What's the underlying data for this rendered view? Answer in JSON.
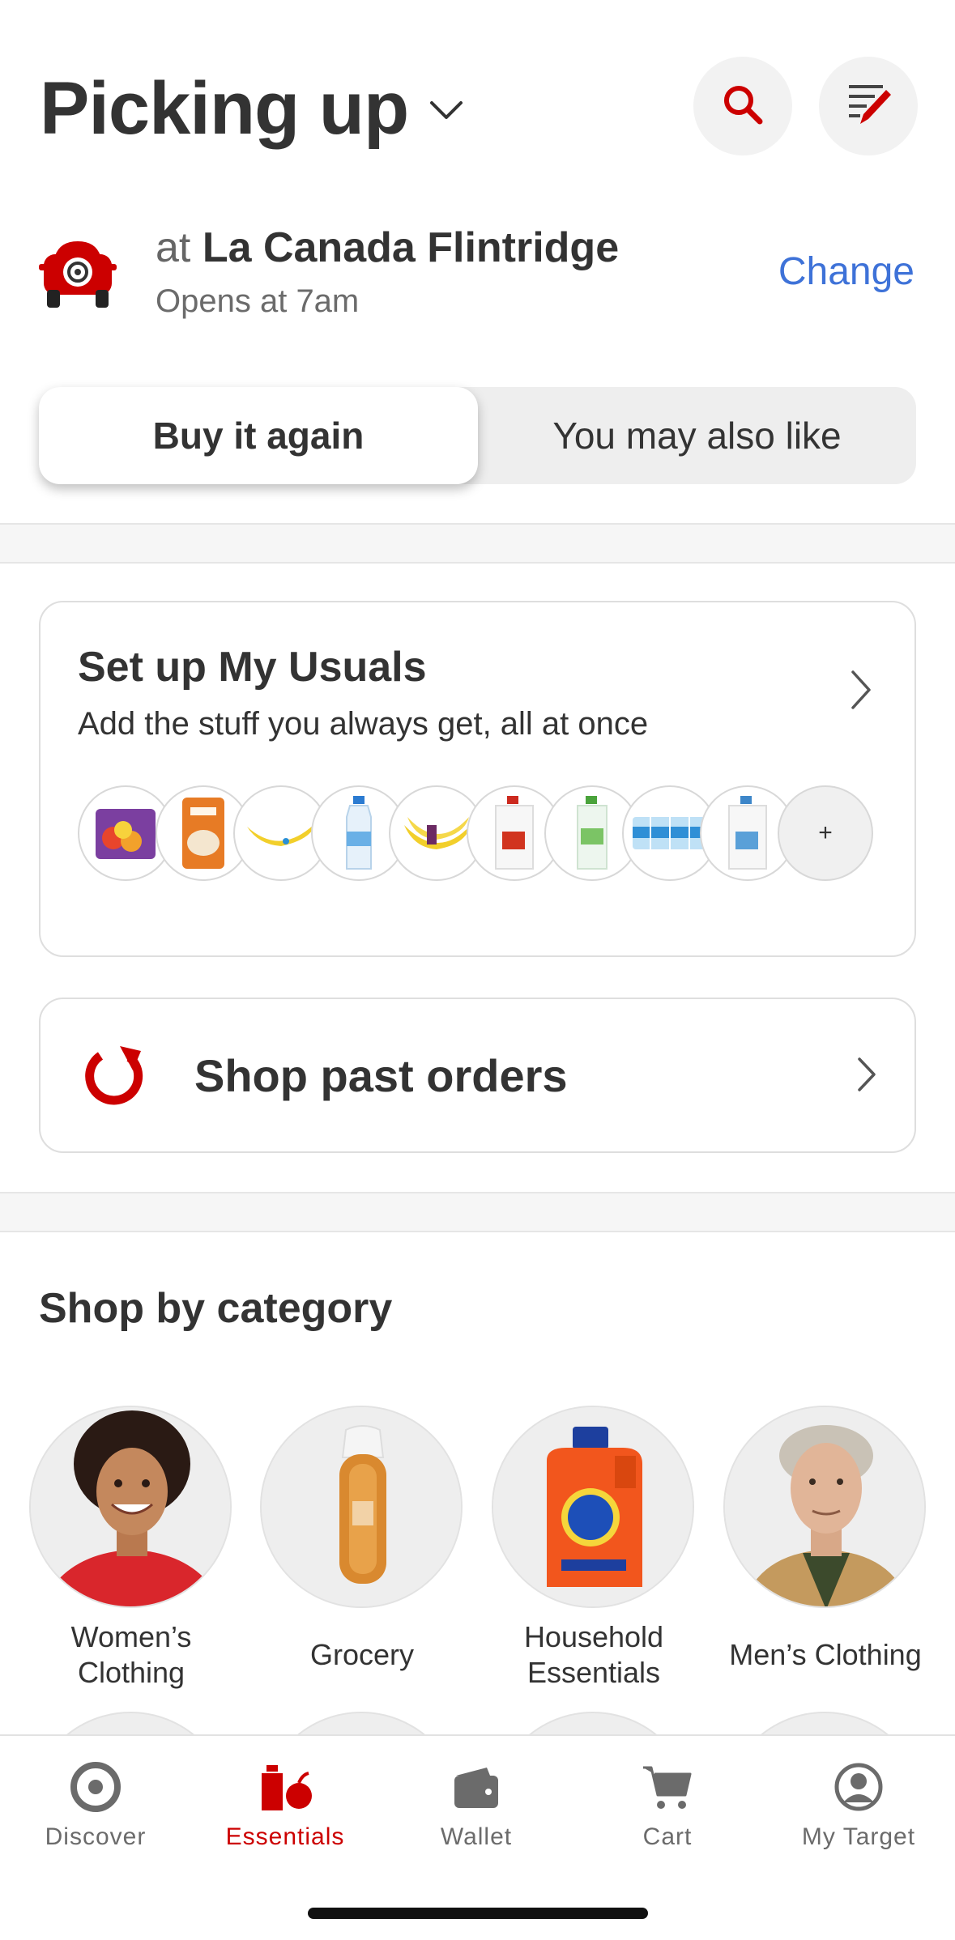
{
  "header": {
    "title": "Picking up",
    "chevron_icon": "chevron-down-icon",
    "search_icon": "search-icon",
    "list_icon": "shopping-list-icon"
  },
  "store": {
    "prefix": "at",
    "name": "La Canada Flintridge",
    "hours": "Opens at 7am",
    "change_label": "Change",
    "icon": "drive-up-car-icon"
  },
  "segmented": {
    "active": "Buy it again",
    "inactive": "You may also like"
  },
  "usuals": {
    "title": "Set up My Usuals",
    "subtitle": "Add the stuff you always get, all at once",
    "more_label": "+",
    "items": [
      "peppers-bag-icon",
      "rice-bag-icon",
      "banana-icon",
      "water-bottle-icon",
      "banana-bunch-icon",
      "milk-gallon-icon",
      "water-jug-icon",
      "water-case-icon",
      "milk-jug-icon"
    ]
  },
  "past_orders": {
    "label": "Shop past orders",
    "icon": "reorder-icon"
  },
  "categories": {
    "title": "Shop by category",
    "items": [
      {
        "label_line1": "Women’s",
        "label_line2": "Clothing"
      },
      {
        "label_line1": "Grocery",
        "label_line2": ""
      },
      {
        "label_line1": "Household",
        "label_line2": "Essentials"
      },
      {
        "label_line1": "Men’s Clothing",
        "label_line2": ""
      }
    ]
  },
  "tabbar": {
    "items": [
      {
        "label": "Discover",
        "icon": "target-logo-icon"
      },
      {
        "label": "Essentials",
        "icon": "essentials-icon"
      },
      {
        "label": "Wallet",
        "icon": "wallet-icon"
      },
      {
        "label": "Cart",
        "icon": "cart-icon"
      },
      {
        "label": "My Target",
        "icon": "account-icon"
      }
    ],
    "active_color": "#cc0000"
  },
  "colors": {
    "brand_red": "#cc0000",
    "link_blue": "#3e72d8"
  }
}
